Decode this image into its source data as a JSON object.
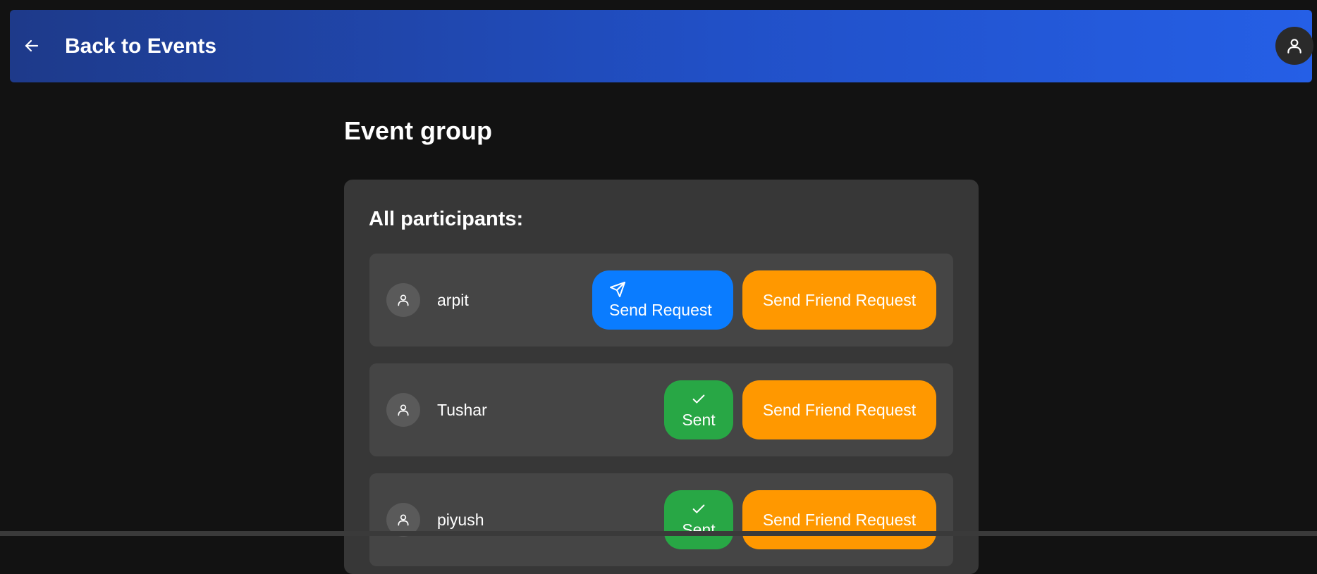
{
  "header": {
    "back_label": "Back to Events",
    "back_icon": "arrow-left-icon",
    "avatar_icon": "user-icon"
  },
  "page": {
    "title": "Event group"
  },
  "participants": {
    "title": "All participants:",
    "items": [
      {
        "name": "arpit",
        "request_label": "Send Request",
        "request_state": "unsent",
        "request_icon": "send-icon",
        "friend_label": "Send Friend Request"
      },
      {
        "name": "Tushar",
        "request_label": "Sent",
        "request_state": "sent",
        "request_icon": "check-icon",
        "friend_label": "Send Friend Request"
      },
      {
        "name": "piyush",
        "request_label": "Sent",
        "request_state": "sent",
        "request_icon": "check-icon",
        "friend_label": "Send Friend Request"
      }
    ]
  },
  "colors": {
    "header_gradient_start": "#1e3a8a",
    "header_gradient_end": "#255fe6",
    "send_request": "#0a7cff",
    "sent": "#28a745",
    "friend_request": "#ff9800",
    "background": "#121212",
    "card": "#373737",
    "row": "#454545"
  }
}
